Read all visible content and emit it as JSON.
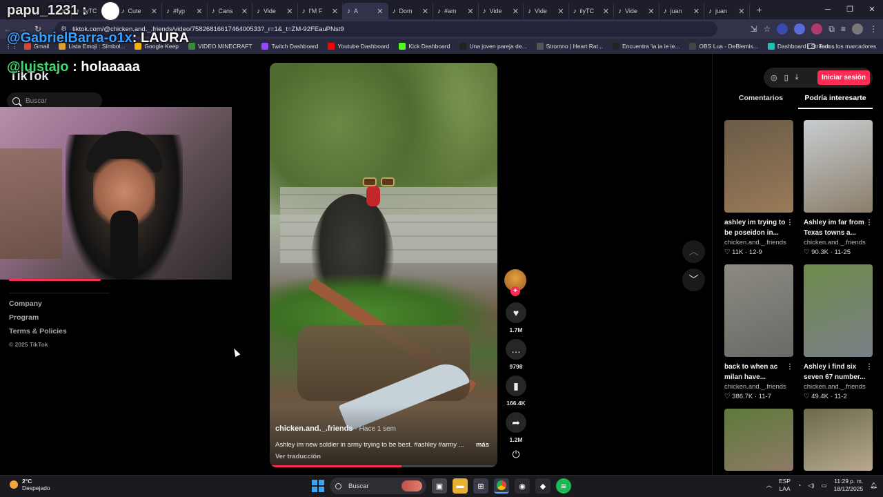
{
  "browser": {
    "tabs": [
      {
        "label": "m"
      },
      {
        "label": "ilyTC"
      },
      {
        "label": "Cute"
      },
      {
        "label": "#fyp"
      },
      {
        "label": "Cans"
      },
      {
        "label": "Vide"
      },
      {
        "label": "I'M F"
      },
      {
        "label": "A",
        "active": true
      },
      {
        "label": "Dom"
      },
      {
        "label": "#am"
      },
      {
        "label": "Vide"
      },
      {
        "label": "Vide"
      },
      {
        "label": "ilyTC"
      },
      {
        "label": "Vide"
      },
      {
        "label": "juan"
      },
      {
        "label": "juan"
      }
    ],
    "new_tab": "+",
    "url": "tiktok.com/@chicken.and._.friends/video/7582681661746400533?_r=1&_t=ZM-92FEauPNst9",
    "bookmarks": [
      {
        "label": "Gmail",
        "color": "#d44638"
      },
      {
        "label": "Lista Emoji : Símbol...",
        "color": "#e0a030"
      },
      {
        "label": "Google Keep",
        "color": "#f4b400"
      },
      {
        "label": "VIDEO MINECRAFT",
        "color": "#3b8a3b"
      },
      {
        "label": "Twitch Dashboard",
        "color": "#9146ff"
      },
      {
        "label": "Youtube Dashboard",
        "color": "#ff0000"
      },
      {
        "label": "Kick Dashboard",
        "color": "#53fc18"
      },
      {
        "label": "Una joven pareja de...",
        "color": "#222222"
      },
      {
        "label": "Stromno | Heart Rat...",
        "color": "#555555"
      },
      {
        "label": "Encuentra 'ia ia ie ie...",
        "color": "#222222"
      },
      {
        "label": "OBS Lua - DeBlemis...",
        "color": "#444444"
      },
      {
        "label": "Dashboard / Stream...",
        "color": "#21c0b0"
      }
    ],
    "all_bookmarks": "Todos los marcadores"
  },
  "tiktok": {
    "logo": "TikTok",
    "search_placeholder": "Buscar",
    "footer": {
      "company": "Company",
      "program": "Program",
      "terms": "Terms & Policies",
      "copyright": "© 2025 TikTok"
    },
    "video": {
      "author": "chicken.and._.friends",
      "time_ago": "· Hace 1 sem",
      "caption": "Ashley im new soldier in army trying to be best. #ashley #army ...",
      "more": "más",
      "translate": "Ver traducción",
      "progress": 0.58
    },
    "actions": {
      "likes": "1.7M",
      "comments": "9798",
      "saves": "166.4K",
      "shares": "1.2M"
    },
    "right_panel": {
      "login": "Iniciar sesión",
      "tabs": [
        "Comentarios",
        "Podría interesarte"
      ],
      "active_tab": "Podría interesarte",
      "cards": [
        {
          "title": "ashley im trying to be poseidon in...",
          "author": "chicken.and._.friends",
          "likes": "11K",
          "date": "12-9",
          "colors": [
            "#6a5b47",
            "#9a7a58"
          ]
        },
        {
          "title": "Ashley im far from Texas towns a...",
          "author": "chicken.and._.friends",
          "likes": "90.3K",
          "date": "11-25",
          "colors": [
            "#c8ccd0",
            "#8a7e6a"
          ]
        },
        {
          "title": "back to when ac milan have...",
          "author": "chicken.and._.friends",
          "likes": "386.7K",
          "date": "11-7",
          "colors": [
            "#8c8a82",
            "#6a6a66"
          ]
        },
        {
          "title": "Ashley i find six seven 67 number...",
          "author": "chicken.and._.friends",
          "likes": "49.4K",
          "date": "11-2",
          "colors": [
            "#6e8a4a",
            "#7a7f88"
          ]
        },
        {
          "title": "",
          "author": "",
          "likes": "",
          "date": "",
          "colors": [
            "#5d7a3a",
            "#8e7a66"
          ]
        },
        {
          "title": "",
          "author": "",
          "likes": "",
          "date": "",
          "colors": [
            "#6a6a4a",
            "#b8a890"
          ]
        }
      ]
    }
  },
  "stream_overlay": {
    "user1": "papu_1231",
    "sep1": ":",
    "user2": "@GabrielBarra-o1x",
    "msg2": ": LAURA",
    "user3": "@luistajo",
    "msg3": " : holaaaaa"
  },
  "taskbar": {
    "temp": "2°C",
    "weather": "Despejado",
    "search": "Buscar",
    "lang1": "ESP",
    "lang2": "LAA",
    "time": "11:29 p. m.",
    "date": "18/12/2025"
  }
}
